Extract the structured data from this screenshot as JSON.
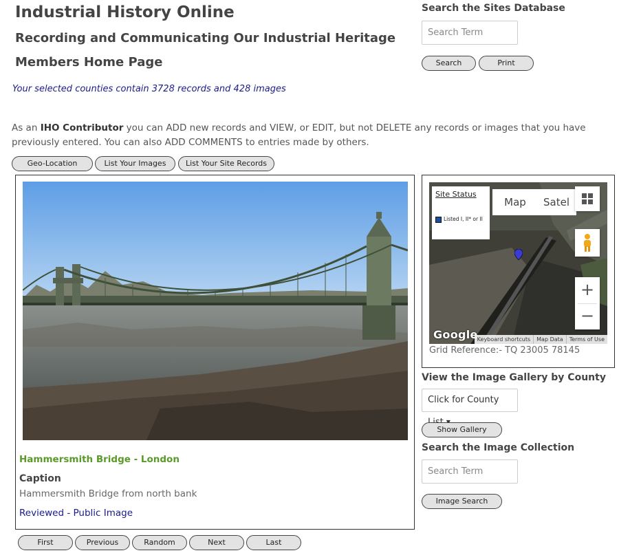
{
  "header": {
    "site_title": "Industrial History Online",
    "tagline": "Recording and Communicating Our Industrial Heritage",
    "page_title": "Members Home Page",
    "counties_info": "Your selected counties contain 3728 records and 428 images"
  },
  "site_search": {
    "heading": "Search the Sites Database",
    "placeholder": "Search Term",
    "search_label": "Search",
    "print_label": "Print"
  },
  "intro": {
    "prefix": "As an ",
    "role": "IHO Contributor",
    "text": " you can ADD new records and VIEW, or EDIT, but not DELETE any records or images that you have previously entered. You can also ADD COMMENTS to entries made by others."
  },
  "toolbar": {
    "geo_location": "Geo-Location",
    "list_images": "List Your Images",
    "list_records": "List Your Site Records"
  },
  "image": {
    "title": "Hammersmith Bridge - London",
    "caption_heading": "Caption",
    "caption": "Hammersmith Bridge from north bank",
    "review_status": "Reviewed - Public Image"
  },
  "image_nav": {
    "first": "First",
    "previous": "Previous",
    "random": "Random",
    "next": "Next",
    "last": "Last"
  },
  "map": {
    "legend_title": "Site Status",
    "legend_item": "Listed I, II* or II",
    "map_type_map": "Map",
    "map_type_satellite": "Satel",
    "zoom_in": "+",
    "zoom_out": "−",
    "google_logo": "Google",
    "attr_shortcuts": "Keyboard shortcuts",
    "attr_data": "Map Data",
    "attr_terms": "Terms of Use",
    "grid_reference": "Grid Reference:- TQ 23005 78145"
  },
  "gallery": {
    "heading": "View the Image Gallery by County",
    "select_value": "Click for County List",
    "show_label": "Show Gallery"
  },
  "image_search": {
    "heading": "Search the Image Collection",
    "placeholder": "Search Term",
    "button_label": "Image Search"
  },
  "colors": {
    "title_green": "#5b9a2a",
    "link_blue": "#1a1a8c",
    "legend_blue": "#1a4fa0"
  }
}
